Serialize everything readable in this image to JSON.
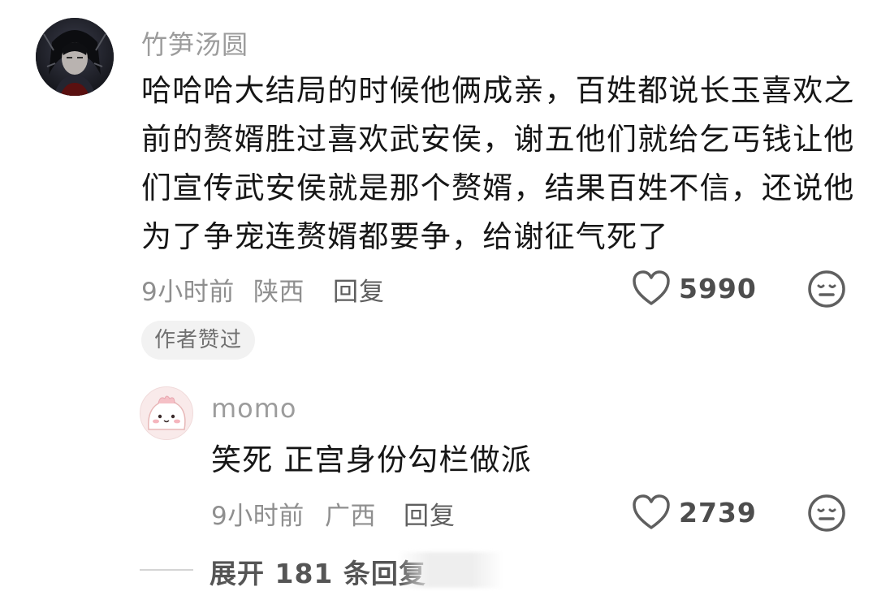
{
  "comment": {
    "username": "竹笋汤圆",
    "text_lines": [
      "哈哈哈大结局的时候他俩成亲，百姓都说长玉喜欢之",
      "前的赘婿胜过喜欢武安侯，谢五他们就给乞丐钱让他",
      "们宣传武安侯就是那个赘婿，结果百姓不信，还说他",
      "为了争宠连赘婿都要争，给谢征气死了"
    ],
    "time": "9小时前",
    "location": "陕西",
    "reply_label": "回复",
    "likes": "5990",
    "badge": "作者赞过",
    "avatar_icon": "dark-character-avatar",
    "like_icon": "heart-outline-icon",
    "emoji_icon": "meh-face-icon"
  },
  "reply": {
    "username": "momo",
    "text": "笑死 正宫身份勾栏做派",
    "time": "9小时前",
    "location": "广西",
    "reply_label": "回复",
    "likes": "2739",
    "avatar_icon": "pink-cartoon-avatar",
    "like_icon": "heart-outline-icon",
    "emoji_icon": "meh-face-icon"
  },
  "expand": {
    "label": "展开 181 条回复"
  },
  "colors": {
    "text_primary": "#161616",
    "text_secondary": "#8f8f8f",
    "username": "#9c9c9c",
    "icon_gray": "#6a6a6a"
  }
}
